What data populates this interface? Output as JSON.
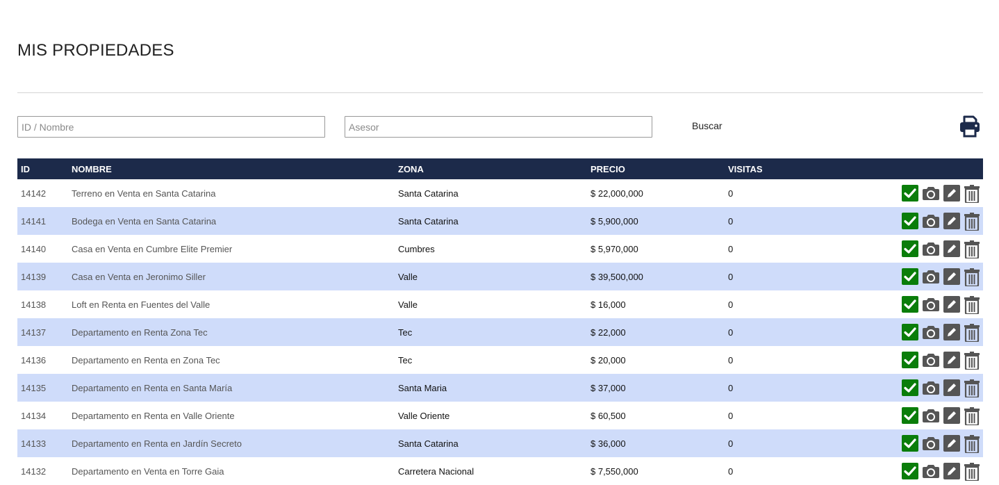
{
  "page": {
    "title": "MIS PROPIEDADES"
  },
  "search": {
    "id_placeholder": "ID / Nombre",
    "asesor_placeholder": "Asesor",
    "buscar_label": "Buscar"
  },
  "table": {
    "headers": {
      "id": "ID",
      "nombre": "NOMBRE",
      "zona": "ZONA",
      "precio": "PRECIO",
      "visitas": "VISITAS"
    },
    "rows": [
      {
        "id": "14142",
        "nombre": "Terreno en Venta en Santa Catarina",
        "zona": "Santa Catarina",
        "precio": "$ 22,000,000",
        "visitas": "0"
      },
      {
        "id": "14141",
        "nombre": "Bodega en Venta en Santa Catarina",
        "zona": "Santa Catarina",
        "precio": "$ 5,900,000",
        "visitas": "0"
      },
      {
        "id": "14140",
        "nombre": "Casa en Venta en Cumbre Elite Premier",
        "zona": "Cumbres",
        "precio": "$ 5,970,000",
        "visitas": "0"
      },
      {
        "id": "14139",
        "nombre": "Casa en Venta en Jeronimo Siller",
        "zona": "Valle",
        "precio": "$ 39,500,000",
        "visitas": "0"
      },
      {
        "id": "14138",
        "nombre": "Loft en Renta en Fuentes del Valle",
        "zona": "Valle",
        "precio": "$ 16,000",
        "visitas": "0"
      },
      {
        "id": "14137",
        "nombre": "Departamento en Renta Zona Tec",
        "zona": "Tec",
        "precio": "$ 22,000",
        "visitas": "0"
      },
      {
        "id": "14136",
        "nombre": "Departamento en Renta en Zona Tec",
        "zona": "Tec",
        "precio": "$ 20,000",
        "visitas": "0"
      },
      {
        "id": "14135",
        "nombre": "Departamento en Renta en Santa María",
        "zona": "Santa Maria",
        "precio": "$ 37,000",
        "visitas": "0"
      },
      {
        "id": "14134",
        "nombre": "Departamento en Renta en Valle Oriente",
        "zona": "Valle Oriente",
        "precio": "$ 60,500",
        "visitas": "0"
      },
      {
        "id": "14133",
        "nombre": "Departamento en Renta en Jardín Secreto",
        "zona": "Santa Catarina",
        "precio": "$ 36,000",
        "visitas": "0"
      },
      {
        "id": "14132",
        "nombre": "Departamento en Venta en Torre Gaia",
        "zona": "Carretera Nacional",
        "precio": "$ 7,550,000",
        "visitas": "0"
      }
    ]
  },
  "icons": {
    "print": "print-icon",
    "row_actions": [
      "check-icon",
      "camera-icon",
      "pencil-icon",
      "trash-icon"
    ]
  },
  "colors": {
    "header_bg": "#1c2a4a",
    "row_alt_bg": "#cfdcfa",
    "check_green": "#0a7d0a",
    "icon_gray": "#555555",
    "print_navy": "#1c2a4a"
  }
}
